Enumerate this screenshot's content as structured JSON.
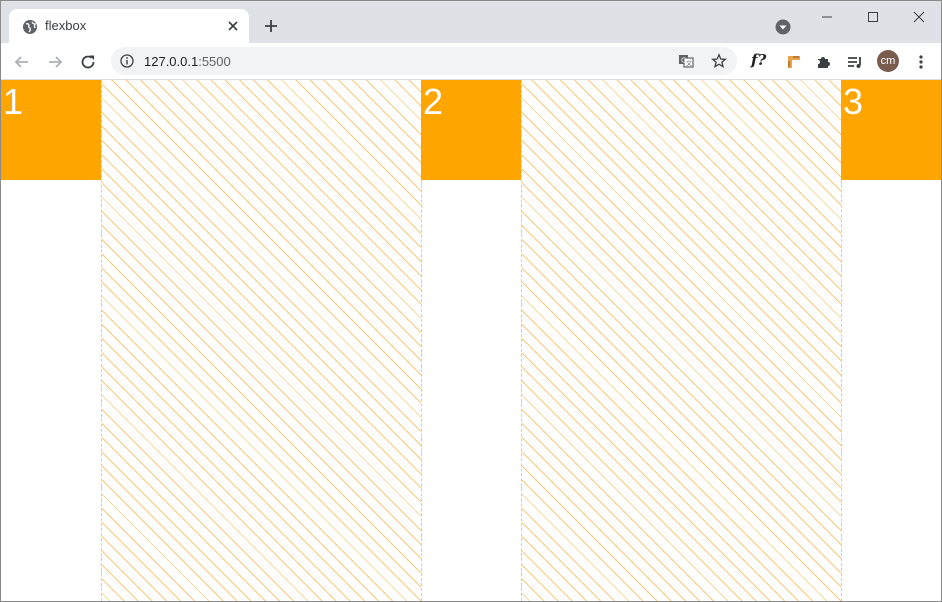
{
  "browser": {
    "tab": {
      "title": "flexbox",
      "favicon": "globe-icon",
      "close_icon": "close-icon"
    },
    "new_tab_icon": "plus-icon",
    "profile_dropdown_icon": "chevron-down-icon",
    "window_controls": [
      "minimize-icon",
      "maximize-icon",
      "close-icon"
    ],
    "toolbar": {
      "back_icon": "back-arrow-icon",
      "forward_icon": "forward-arrow-icon",
      "reload_icon": "reload-icon",
      "site_info_icon": "info-icon",
      "url_host": "127.0.0.1",
      "url_port": ":5500",
      "translate_icon": "translate-icon",
      "bookmark_icon": "star-icon",
      "extensions": [
        "fx-extension",
        "ruler-extension-icon",
        "puzzle-icon",
        "playlist-icon"
      ],
      "fx_label": "f?",
      "avatar_initials": "cm",
      "menu_icon": "more-vertical-icon"
    }
  },
  "page": {
    "items": [
      {
        "label": "1"
      },
      {
        "label": "2"
      },
      {
        "label": "3"
      }
    ],
    "colors": {
      "item_background": "#ffa500",
      "item_text": "#ffffff",
      "gap_hatch": "#f7c46d"
    }
  }
}
